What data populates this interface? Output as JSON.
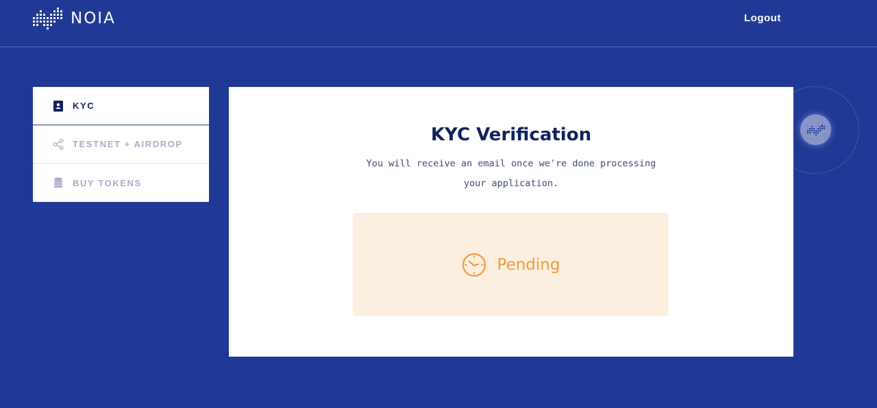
{
  "header": {
    "brand": "NOIA",
    "logo_icon": "noia-dots-logo-icon",
    "logout_label": "Logout"
  },
  "sidebar": {
    "items": [
      {
        "label": "KYC",
        "icon": "id-card-icon",
        "active": true
      },
      {
        "label": "TESTNET + AIRDROP",
        "icon": "share-nodes-icon",
        "active": false
      },
      {
        "label": "BUY TOKENS",
        "icon": "coin-stack-icon",
        "active": false
      }
    ]
  },
  "main": {
    "title": "KYC Verification",
    "description": "You will receive an email once we're done processing your application.",
    "status": {
      "label": "Pending",
      "icon": "clock-icon"
    }
  },
  "widget": {
    "icon": "noia-dots-icon"
  },
  "colors": {
    "background": "#1f3996",
    "card": "#ffffff",
    "title": "#12215e",
    "pending_bg": "#fcefdf",
    "pending_accent": "#f19a3e",
    "inactive_nav": "#a8acc6"
  }
}
